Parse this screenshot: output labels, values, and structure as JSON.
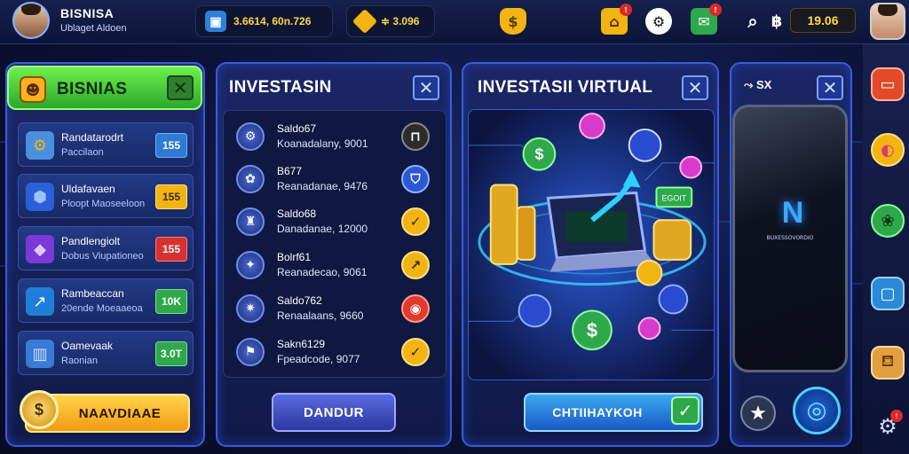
{
  "header": {
    "title": "BISNISA",
    "subtitle": "Ublaget Aldoen",
    "currency": "3.6614, 60n.726",
    "gems": "3.096",
    "timer": "19.06",
    "notif_1": "!",
    "notif_2": "!",
    "notif_3": "!"
  },
  "panel_bisnis": {
    "title": "BISNIAS",
    "items": [
      {
        "label": "Randatarodrt",
        "sub": "Paccilaon",
        "badge": "155",
        "badge_color": "#2e7bd6",
        "icon": "gear-icon"
      },
      {
        "label": "Uldafavaen",
        "sub": "Ploopt Maoseeloon",
        "badge": "155",
        "badge_color": "#f2b412",
        "icon": "cube-icon"
      },
      {
        "label": "Pandlengiolt",
        "sub": "Dobus Viupationeo",
        "badge": "155",
        "badge_color": "#d93030",
        "icon": "diamond-icon"
      },
      {
        "label": "Rambeaccan",
        "sub": "20ende Moeaaeoa",
        "badge": "10K",
        "badge_color": "#2ea84a",
        "icon": "chart-icon"
      },
      {
        "label": "Oamevaak",
        "sub": "Raonian",
        "badge": "3.0T",
        "badge_color": "#2ea84a",
        "icon": "building-icon"
      }
    ],
    "button": "NAAVDIAAE"
  },
  "panel_invest": {
    "title": "INVESTASIN",
    "items": [
      {
        "label": "Saldo67",
        "value": "Koanadalany, 9001",
        "icon_color": "#2b2b2b"
      },
      {
        "label": "B677",
        "value": "Reanadanae, 9476",
        "icon_color": "#2b58d6"
      },
      {
        "label": "Saldo68",
        "value": "Danadanae, 12000",
        "icon_color": "#f2b412"
      },
      {
        "label": "Bolrf61",
        "value": "Reanadecao, 9061",
        "icon_color": "#f2b412"
      },
      {
        "label": "Saldo762",
        "value": "Renaalaans, 9660",
        "icon_color": "#e23a2a"
      },
      {
        "label": "Sakn6129",
        "value": "Fpeadcode, 9077",
        "icon_color": "#f2b412"
      }
    ],
    "button": "DANDUR"
  },
  "panel_virtual": {
    "title": "INVESTASII VIRTUAL",
    "button": "CHTIIHAYKOH",
    "sign": "EGOIT"
  },
  "panel_phone": {
    "title": "SX",
    "brand": "BUXESSOVORDIO",
    "logo": "N"
  }
}
